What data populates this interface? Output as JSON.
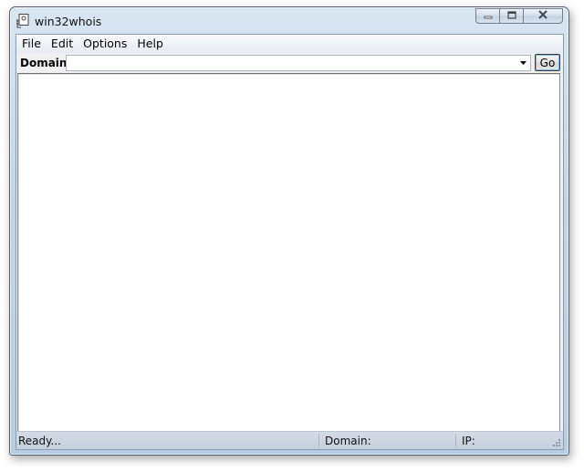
{
  "window": {
    "title": "win32whois",
    "app_icon": "app-document-icon",
    "controls": {
      "minimize_icon": "minimize-icon",
      "maximize_icon": "maximize-icon",
      "close_icon": "close-icon"
    }
  },
  "menu": {
    "items": [
      {
        "label": "File"
      },
      {
        "label": "Edit"
      },
      {
        "label": "Options"
      },
      {
        "label": "Help"
      }
    ]
  },
  "toolbar": {
    "domain_label": "Domain",
    "domain_value": "",
    "domain_placeholder": "",
    "dropdown_icon": "chevron-down-icon",
    "go_label": "Go"
  },
  "output": {
    "text": ""
  },
  "status": {
    "ready": "Ready...",
    "domain": "Domain:",
    "ip": "IP:",
    "grip_icon": "resize-grip-icon"
  },
  "colors": {
    "frame": "#c3d5e8",
    "client_bg": "#f0f0f0",
    "output_bg": "#ffffff"
  }
}
